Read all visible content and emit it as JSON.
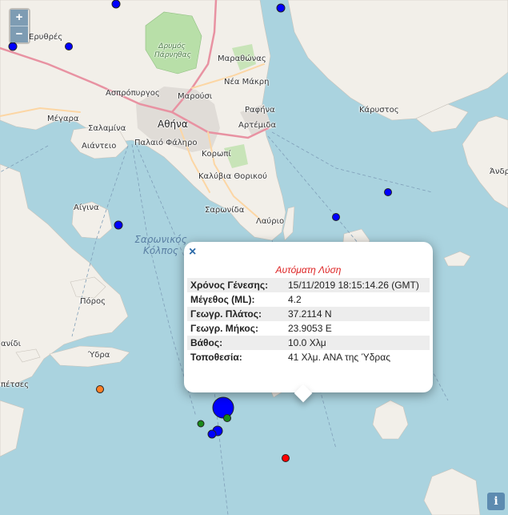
{
  "map": {
    "zoom_in": "+",
    "zoom_out": "−",
    "info": "i",
    "labels": {
      "erythres": "Ερυθρές",
      "park": "Δρυμός Πάρνηθας",
      "marathonas": "Μαραθώνας",
      "aspropyrgos": "Ασπρόπυργος",
      "marousi": "Μαρούσι",
      "nea_makri": "Νέα Μάκρη",
      "megara": "Μέγαρα",
      "athina": "Αθήνα",
      "rafina": "Ραφήνα",
      "karystos": "Κάρυστος",
      "salamina": "Σαλαμίνα",
      "artemida": "Αρτέμιδα",
      "aianteio": "Αιάντειο",
      "palaio_faliro": "Παλαιό Φάληρο",
      "koropi": "Κορωπί",
      "andros": "Άνδρ",
      "kalyvia": "Καλύβια Θορικού",
      "aigina": "Αίγινα",
      "saronida": "Σαρωνίδα",
      "lavrio": "Λαύριο",
      "saronikos": "Σαρωνικός Κόλπος",
      "poros": "Πόρος",
      "ydra": "Ύδρα",
      "anidi": "ανίδι",
      "spetses": "πέτσες"
    }
  },
  "popup": {
    "close": "×",
    "title": "Αυτόματη Λύση",
    "rows": [
      {
        "k": "Χρόνος Γένεσης:",
        "v": "15/11/2019 18:15:14.26 (GMT)"
      },
      {
        "k": "Μέγεθος (ML):",
        "v": "4.2"
      },
      {
        "k": "Γεωγρ. Πλάτος:",
        "v": "37.2114 N"
      },
      {
        "k": "Γεωγρ. Μήκος:",
        "v": "23.9053 E"
      },
      {
        "k": "Βάθος:",
        "v": "10.0 Χλμ"
      },
      {
        "k": "Τοποθεσία:",
        "v": "41 Χλμ. ΑΝΑ της Ύδρας"
      }
    ]
  },
  "colors": {
    "sea": "#aad3df",
    "land": "#f2efe9",
    "urban": "#e0dcd7",
    "forest": "#b8dfa8",
    "motorway": "#e892a2",
    "primary": "#fcd6a4",
    "quake_blue": "#0000ff",
    "quake_green": "#1a8a1a",
    "quake_red": "#ff0000",
    "quake_orange": "#ff7f27"
  }
}
